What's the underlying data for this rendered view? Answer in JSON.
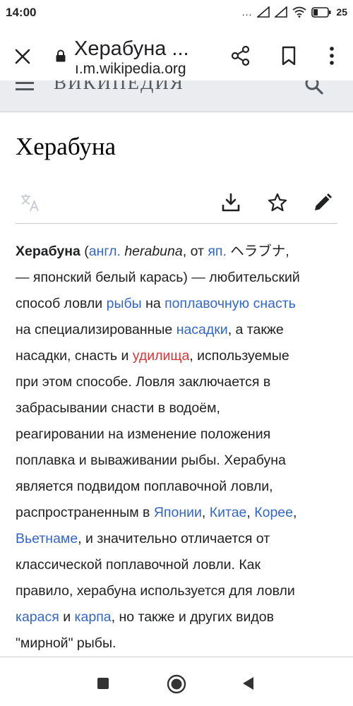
{
  "status_bar": {
    "time": "14:00",
    "dots": "...",
    "battery": "25"
  },
  "toolbar": {
    "title": "Херабуна ...",
    "url": "ı.m.wikipedia.org"
  },
  "wiki_header": {
    "wordmark": "ВИКИПЕДИЯ"
  },
  "page": {
    "heading": "Херабуна"
  },
  "article": {
    "l1": {
      "bold": "Херабуна",
      "t1": " (",
      "link1": "англ.",
      "t2": " ",
      "italic": "herabuna",
      "t3": ", от ",
      "link2": "яп.",
      "t4": " ヘラブナ,"
    },
    "l2": "— японский белый карась) — любительский",
    "l3": {
      "t1": "способ ловли ",
      "link1": "рыбы",
      "t2": " на ",
      "link2": "поплавочную снасть"
    },
    "l4": {
      "t1": "на специализированные ",
      "link1": "насадки",
      "t2": ", а также"
    },
    "l5": {
      "t1": "насадки, снасть и ",
      "redlink": "удилища",
      "t2": ", используемые"
    },
    "l6": "при этом способе. Ловля заключается в",
    "l7": "забрасывании снасти в водоём,",
    "l8": "реагировании на изменение положения",
    "l9": "поплавка и вываживании рыбы. Херабуна",
    "l10": "является подвидом поплавочной ловли,",
    "l11": {
      "t1": "распространенным в ",
      "link1": "Японии",
      "t2": ", ",
      "link2": "Китае",
      "t3": ", ",
      "link3": "Корее",
      "t4": ","
    },
    "l12": {
      "link1": "Вьетнаме",
      "t1": ", и значительно отличается от"
    },
    "l13": "классической поплавочной ловли. Как",
    "l14": "правило, херабуна используется для ловли",
    "l15": {
      "link1": "карася",
      "t1": " и ",
      "link2": "карпа",
      "t2": ", но также и других видов"
    },
    "l16": "\"мирной\" рыбы."
  },
  "colors": {
    "link": "#3366cc",
    "redlink": "#dd3333",
    "header_bg": "#eaecf0",
    "text": "#202122"
  }
}
